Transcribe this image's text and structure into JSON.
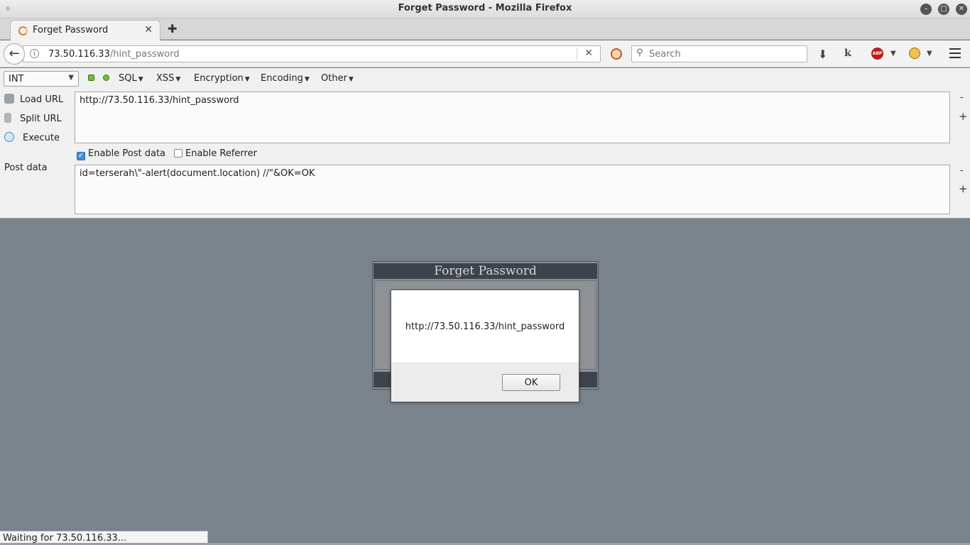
{
  "window": {
    "title": "Forget Password - Mozilla Firefox"
  },
  "tabs": [
    {
      "label": "Forget Password",
      "close": "✕"
    }
  ],
  "new_tab": "✚",
  "navbar": {
    "url_host": "73.50.116.33",
    "url_path": "/hint_password",
    "search_placeholder": "Search"
  },
  "hackbar": {
    "select_value": "INT",
    "menus": [
      "SQL",
      "XSS",
      "Encryption",
      "Encoding",
      "Other"
    ],
    "actions": {
      "load": "Load URL",
      "split": "Split URL",
      "execute": "Execute"
    },
    "url_value": "http://73.50.116.33/hint_password",
    "enable_post_label": "Enable Post data",
    "enable_post_checked": true,
    "enable_referrer_label": "Enable Referrer",
    "enable_referrer_checked": false,
    "post_label": "Post data",
    "post_value": "id=terserah\\\"-alert(document.location) //\"&OK=OK",
    "side_minus": "-",
    "side_plus": "+"
  },
  "page": {
    "card_title": "Forget Password"
  },
  "alert": {
    "message": "http://73.50.116.33/hint_password",
    "ok_label": "OK"
  },
  "status": {
    "text": "Waiting for 73.50.116.33..."
  }
}
